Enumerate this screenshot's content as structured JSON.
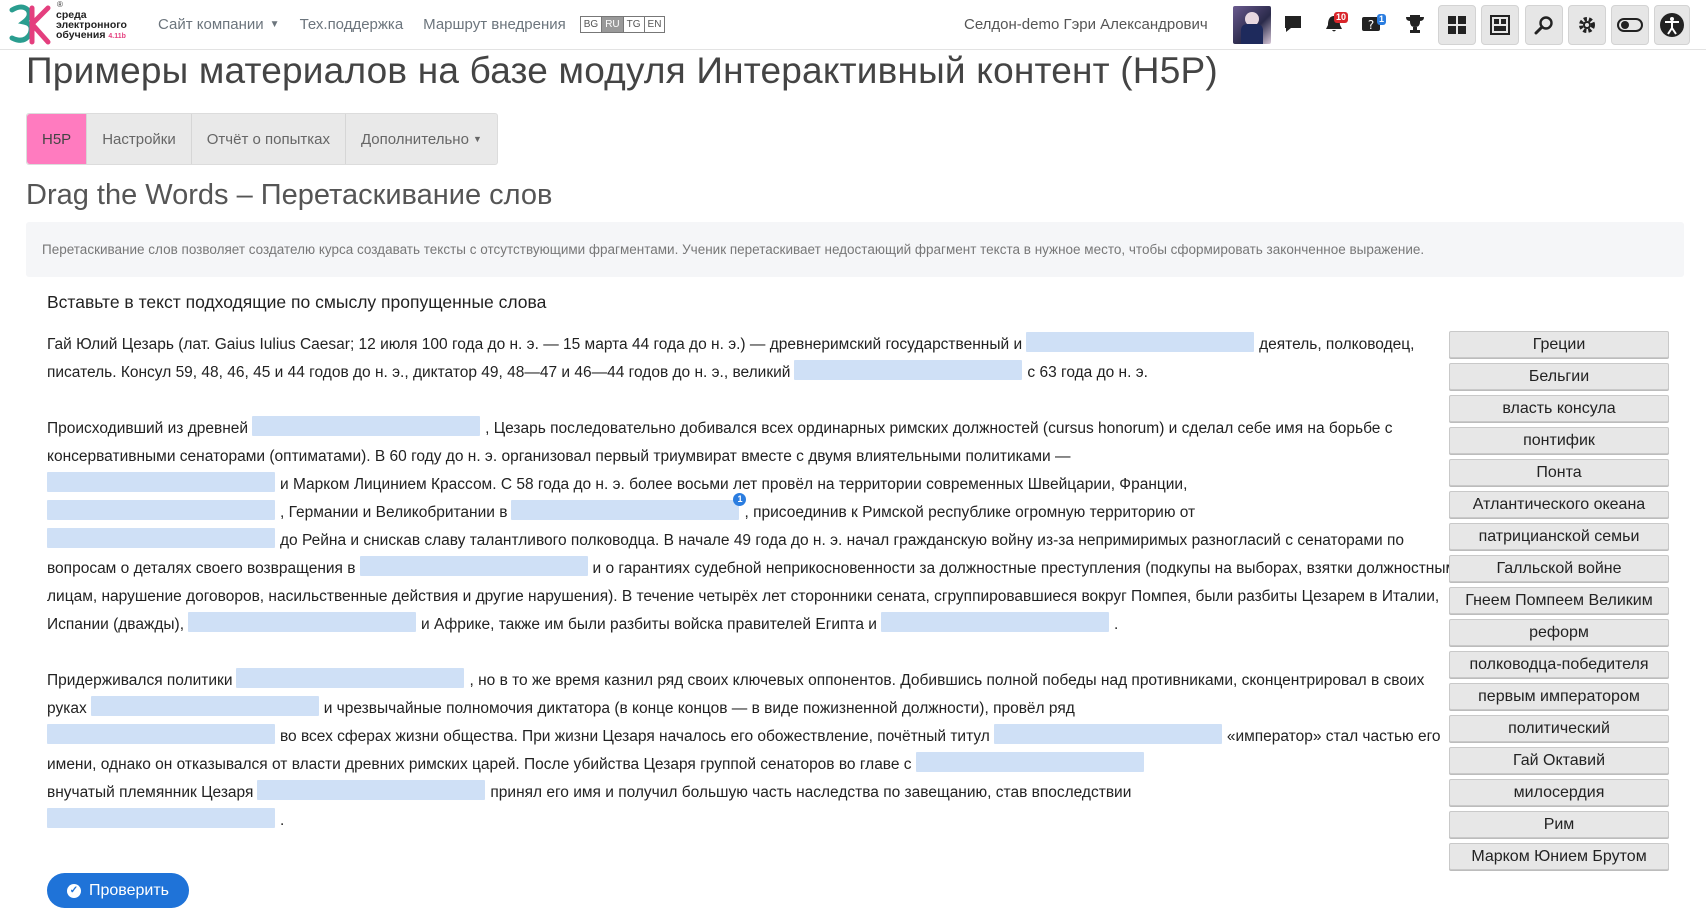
{
  "logo": {
    "line1": "среда",
    "line2": "электронного",
    "line3": "обучения",
    "version": "4.11b",
    "registered": "®"
  },
  "topnav": {
    "company_site": "Сайт компании",
    "support": "Тех.поддержка",
    "roadmap": "Маршрут внедрения",
    "languages": [
      "BG",
      "RU",
      "TG",
      "EN"
    ],
    "active_language": "RU"
  },
  "user": {
    "name": "Селдон-demo Гэри Александрович"
  },
  "header_icons": {
    "notifications_count": "10",
    "questions_count": "1"
  },
  "page": {
    "title": "Примеры материалов на базе модуля Интерактивный контент (H5P)",
    "tabs": [
      "H5P",
      "Настройки",
      "Отчёт о попытках",
      "Дополнительно"
    ],
    "section_title": "Drag the Words – Перетаскивание слов",
    "intro": "Перетаскивание слов позволяет создателю курса создавать тексты с отсутствующими фрагментами. Ученик перетаскивает недостающий фрагмент текста в нужное место, чтобы сформировать законченное выражение."
  },
  "task": {
    "title": "Вставьте в текст подходящие по смыслу пропущенные слова",
    "p1": {
      "s1": "Гай Юлий Цезарь (лат. Gaius Iulius Caesar; 12 июля 100 года до н. э. — 15 марта 44 года до н. э.) — древнеримский государственный и",
      "s2": "деятель, полководец, писатель. Консул 59, 48, 46, 45 и 44 годов до н. э., диктатор 49, 48—47 и 46—44 годов до н. э., великий",
      "s3": "с 63 года до н. э."
    },
    "p2": {
      "s1": "Происходивший из древней",
      "s2": ", Цезарь последовательно добивался всех ординарных римских должностей (cursus honorum) и сделал себе имя на борьбе с консервативными сенаторами (оптиматами). В 60 году до н. э. организовал первый триумвират вместе с двумя влиятельными политиками —",
      "s3": "и Марком Лицинием Крассом. С 58 года до н. э. более восьми лет провёл на территории современных Швейцарии, Франции,",
      "s4": ", Германии и Великобритании в",
      "s5": ", присоединив к Римской республике огромную территорию от",
      "s6": "до Рейна и снискав славу талантливого полководца. В начале 49 года до н. э. начал гражданскую войну из-за непримиримых разногласий с сенаторами по вопросам о деталях своего возвращения в",
      "s7": "и о гарантиях судебной неприкосновенности за должностные преступления (подкупы на выборах, взятки должностным лицам, нарушение договоров, насильственные действия и другие нарушения). В течение четырёх лет сторонники сената, сгруппировавшиеся вокруг Помпея, были разбиты Цезарем в Италии, Испании (дважды),",
      "s8": "и Африке, также им были разбиты войска правителей Египта и",
      "s9": ".",
      "note": "1"
    },
    "p3": {
      "s1": "Придерживался политики",
      "s2": ", но в то же время казнил ряд своих ключевых оппонентов. Добившись полной победы над противниками, сконцентрировал в своих руках",
      "s3": "и чрезвычайные полномочия диктатора (в конце концов — в виде пожизненной должности), провёл ряд",
      "s4": "во всех сферах жизни общества. При жизни Цезаря началось его обожествление, почётный титул",
      "s5": "«император» стал частью его имени, однако он отказывался от власти древних римских царей. После убийства Цезаря группой сенаторов во главе с",
      "s6": "внучатый племянник Цезаря",
      "s7": "принял его имя и получил большую часть наследства по завещанию, став впоследствии",
      "s8": "."
    },
    "words": [
      "Греции",
      "Бельгии",
      "власть консула",
      "понтифик",
      "Понта",
      "Атлантического океана",
      "патрицианской семьи",
      "Галльской войне",
      "Гнеем Помпеем Великим",
      "реформ",
      "полководца-победителя",
      "первым императором",
      "политический",
      "Гай Октавий",
      "милосердия",
      "Рим",
      "Марком Юнием Брутом"
    ],
    "check_button": "Проверить"
  },
  "colors": {
    "accent_tab": "#ff7bbf",
    "drop_zone": "#cfe0f6",
    "check_button": "#1f73d8"
  }
}
